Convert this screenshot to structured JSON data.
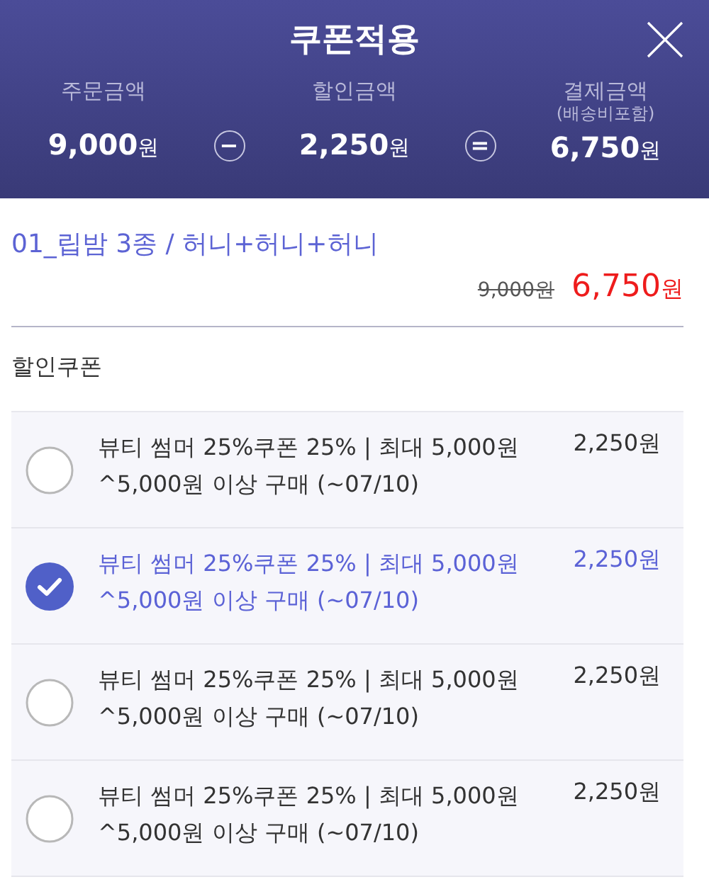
{
  "header": {
    "title": "쿠폰적용",
    "summary": [
      {
        "label": "주문금액",
        "amount": "9,000",
        "unit": "원",
        "operator": "−"
      },
      {
        "label": "할인금액",
        "amount": "2,250",
        "unit": "원",
        "operator": "="
      },
      {
        "label": "결제금액",
        "note": "(배송비포함)",
        "amount": "6,750",
        "unit": "원"
      }
    ]
  },
  "product": {
    "name": "01_립밤 3종 / 허니+허니+허니",
    "original_price": "9,000원",
    "sale_amount": "6,750",
    "sale_unit": "원"
  },
  "coupon_section": {
    "title": "할인쿠폰",
    "coupons": [
      {
        "name": "뷰티 썸머 25%쿠폰 25% | 최대 5,000원",
        "condition": "^5,000원 이상 구매 (~07/10)",
        "discount": "2,250원",
        "selected": false
      },
      {
        "name": "뷰티 썸머 25%쿠폰 25% | 최대 5,000원",
        "condition": "^5,000원 이상 구매 (~07/10)",
        "discount": "2,250원",
        "selected": true
      },
      {
        "name": "뷰티 썸머 25%쿠폰 25% | 최대 5,000원",
        "condition": "^5,000원 이상 구매 (~07/10)",
        "discount": "2,250원",
        "selected": false
      },
      {
        "name": "뷰티 썸머 25%쿠폰 25% | 최대 5,000원",
        "condition": "^5,000원 이상 구매 (~07/10)",
        "discount": "2,250원",
        "selected": false
      }
    ]
  }
}
